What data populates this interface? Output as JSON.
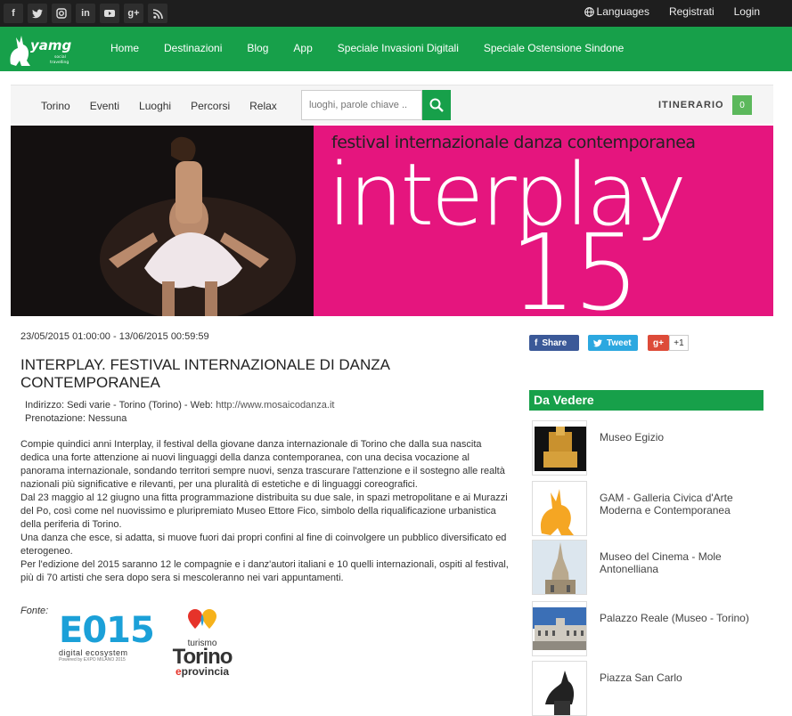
{
  "topbar": {
    "social": [
      {
        "icon": "facebook-icon",
        "glyph": "f"
      },
      {
        "icon": "twitter-icon",
        "glyph": "t"
      },
      {
        "icon": "instagram-icon",
        "glyph": "◎"
      },
      {
        "icon": "linkedin-icon",
        "glyph": "in"
      },
      {
        "icon": "youtube-icon",
        "glyph": "▶"
      },
      {
        "icon": "googleplus-icon",
        "glyph": "g+"
      },
      {
        "icon": "rss-icon",
        "glyph": "◔"
      }
    ],
    "languages": "Languages",
    "register": "Registrati",
    "login": "Login"
  },
  "brand": {
    "logo_text": "yamgu",
    "logo_sub": "social travelling"
  },
  "mainnav": [
    "Home",
    "Destinazioni",
    "Blog",
    "App",
    "Speciale Invasioni Digitali",
    "Speciale Ostensione Sindone"
  ],
  "subnav": {
    "links": [
      "Torino",
      "Eventi",
      "Luoghi",
      "Percorsi",
      "Relax"
    ],
    "search_placeholder": "luoghi, parole chiave ..",
    "itinerary_label": "ITINERARIO",
    "itinerary_count": "0"
  },
  "banner": {
    "subtitle": "festival internazionale danza contemporanea",
    "title": "interplay",
    "number": "15"
  },
  "event": {
    "date": "23/05/2015 01:00:00 - 13/06/2015 00:59:59",
    "title": "INTERPLAY. FESTIVAL INTERNAZIONALE DI DANZA CONTEMPORANEA",
    "address": "Indirizzo: Sedi varie - Torino (Torino) - Web: ",
    "web": "http://www.mosaicodanza.it",
    "booking": "Prenotazione: Nessuna",
    "paragraphs": [
      "Compie quindici anni Interplay, il festival della giovane danza internazionale di Torino che dalla sua nascita dedica una forte attenzione ai nuovi linguaggi della danza contemporanea, con una decisa vocazione al panorama internazionale, sondando territori sempre nuovi, senza trascurare l'attenzione e il sostegno alle realtà nazionali più significative e rilevanti, per una pluralità di estetiche e di linguaggi coreografici.",
      "Dal 23 maggio al 12 giugno una fitta programmazione distribuita su due sale, in spazi metropolitane e ai Murazzi del Po, così come nel nuovissimo e pluripremiato Museo Ettore Fico, simbolo della riqualificazione urbanistica della periferia di Torino.",
      "Una danza che esce, si adatta, si muove fuori dai propri confini al fine di coinvolgere un pubblico diversificato ed eterogeneo.",
      "Per l'edizione del 2015 saranno 12 le compagnie e i danz'autori italiani e 10 quelli internazionali, ospiti al festival, più di 70 artisti che sera dopo sera si mescoleranno nei vari appuntamenti."
    ],
    "source_label": "Fonte:"
  },
  "sources": {
    "e015_big": "E015",
    "e015_small": "digital ecosystem",
    "e015_tiny": "Powered by EXPO MILANO 2015",
    "torino_l1": "turismo",
    "torino_l2": "Torino",
    "torino_e": "e",
    "torino_l3": "provincia"
  },
  "share": {
    "facebook": "Share",
    "twitter": "Tweet",
    "gplus": "g+",
    "gplus_count": "+1"
  },
  "sidebar": {
    "heading": "Da Vedere",
    "items": [
      {
        "label": "Museo Egizio"
      },
      {
        "label": "GAM - Galleria Civica d'Arte Moderna e Contemporanea"
      },
      {
        "label": "Museo del Cinema - Mole Antonelliana"
      },
      {
        "label": "Palazzo Reale (Museo - Torino)"
      },
      {
        "label": "Piazza San Carlo"
      }
    ]
  },
  "colors": {
    "brand_green": "#17a04a",
    "banner_pink": "#e5157e",
    "topbar": "#1e1e1e"
  }
}
